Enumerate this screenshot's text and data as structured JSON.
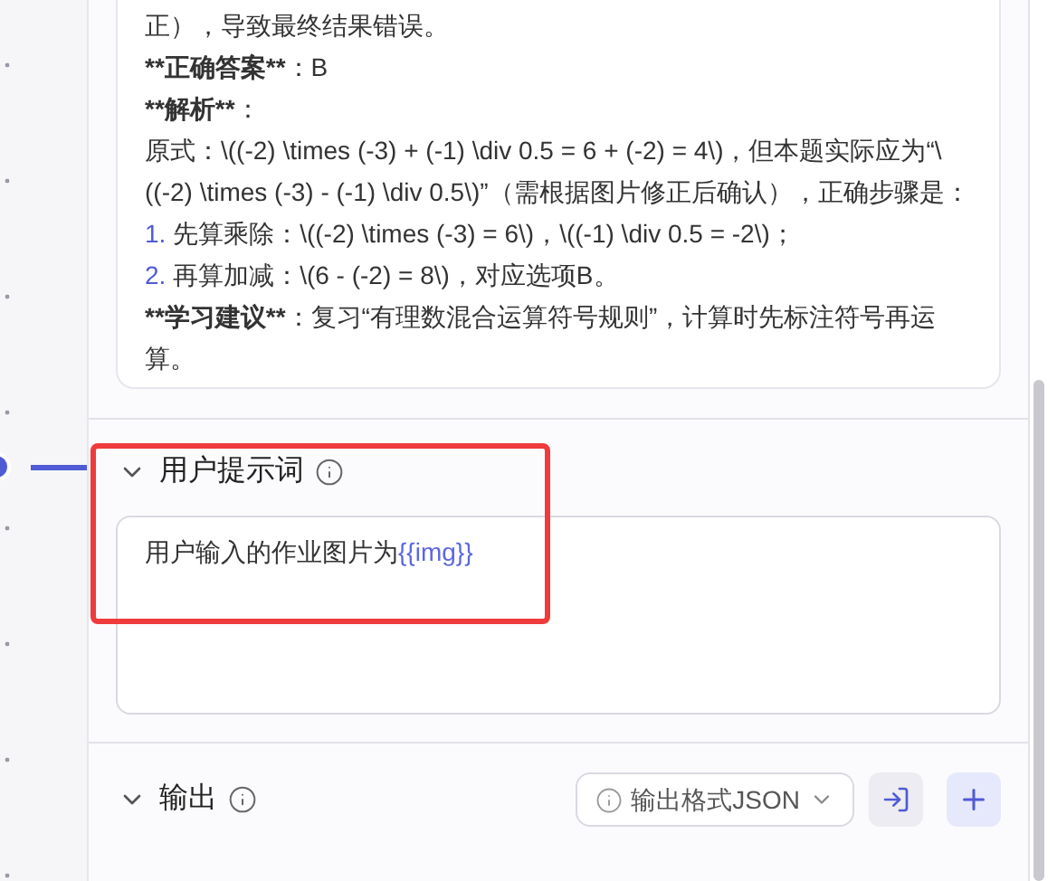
{
  "answer_card": {
    "lines": [
      {
        "kind": "plain",
        "text": "正），导致最终结果错误。"
      },
      {
        "kind": "labeled",
        "label": "**正确答案**",
        "text": "：B"
      },
      {
        "kind": "labeled",
        "label": "**解析**",
        "text": "："
      },
      {
        "kind": "plain",
        "text": "原式：\\((-2) \\times (-3) + (-1) \\div 0.5 = 6 + (-2) = 4\\)，但本题实际应为“\\((-2) \\times (-3) - (-1) \\div 0.5\\)”（需根据图片修正后确认），正确步骤是："
      },
      {
        "kind": "numbered",
        "number": "1.",
        "text": "先算乘除：\\((-2) \\times (-3) = 6\\)，\\((-1) \\div 0.5 = -2\\)；"
      },
      {
        "kind": "numbered",
        "number": "2.",
        "text": "再算加减：\\(6 - (-2) = 8\\)，对应选项B。"
      },
      {
        "kind": "labeled",
        "label": "**学习建议**",
        "text": "：复习“有理数混合运算符号规则”，计算时先标注符号再运算。"
      }
    ]
  },
  "user_prompt": {
    "title": "用户提示词",
    "expanded": true,
    "value": "用户输入的作业图片为",
    "variable": "{{img}}"
  },
  "output": {
    "title": "输出",
    "expanded": true,
    "format_label": "输出格式JSON"
  }
}
